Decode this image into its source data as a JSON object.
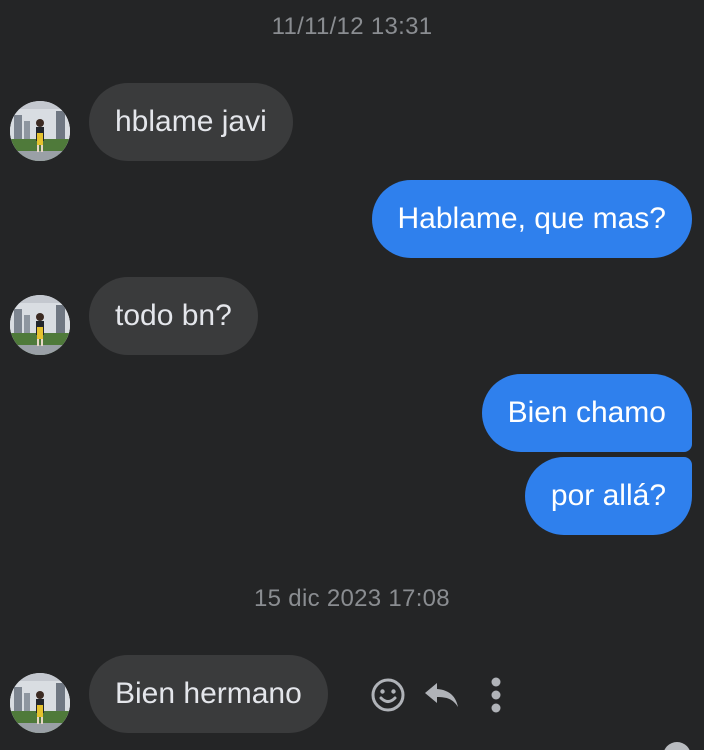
{
  "conversation": {
    "timestamps": [
      "11/11/12 13:31",
      "15 dic 2023 17:08"
    ],
    "messages": [
      {
        "direction": "incoming",
        "text": "hblame javi"
      },
      {
        "direction": "outgoing",
        "text": "Hablame, que mas?"
      },
      {
        "direction": "incoming",
        "text": "todo bn?"
      },
      {
        "direction": "outgoing",
        "text": "Bien chamo"
      },
      {
        "direction": "outgoing",
        "text": "por allá?"
      },
      {
        "direction": "incoming",
        "text": "Bien hermano"
      }
    ]
  },
  "message_actions": {
    "icons": [
      "smiley-icon",
      "reply-icon",
      "more-vertical-icon"
    ]
  },
  "colors": {
    "background": "#242526",
    "incoming_bubble": "#3a3b3c",
    "outgoing_bubble": "#2f80ed",
    "timestamp_text": "#8a8d91"
  }
}
